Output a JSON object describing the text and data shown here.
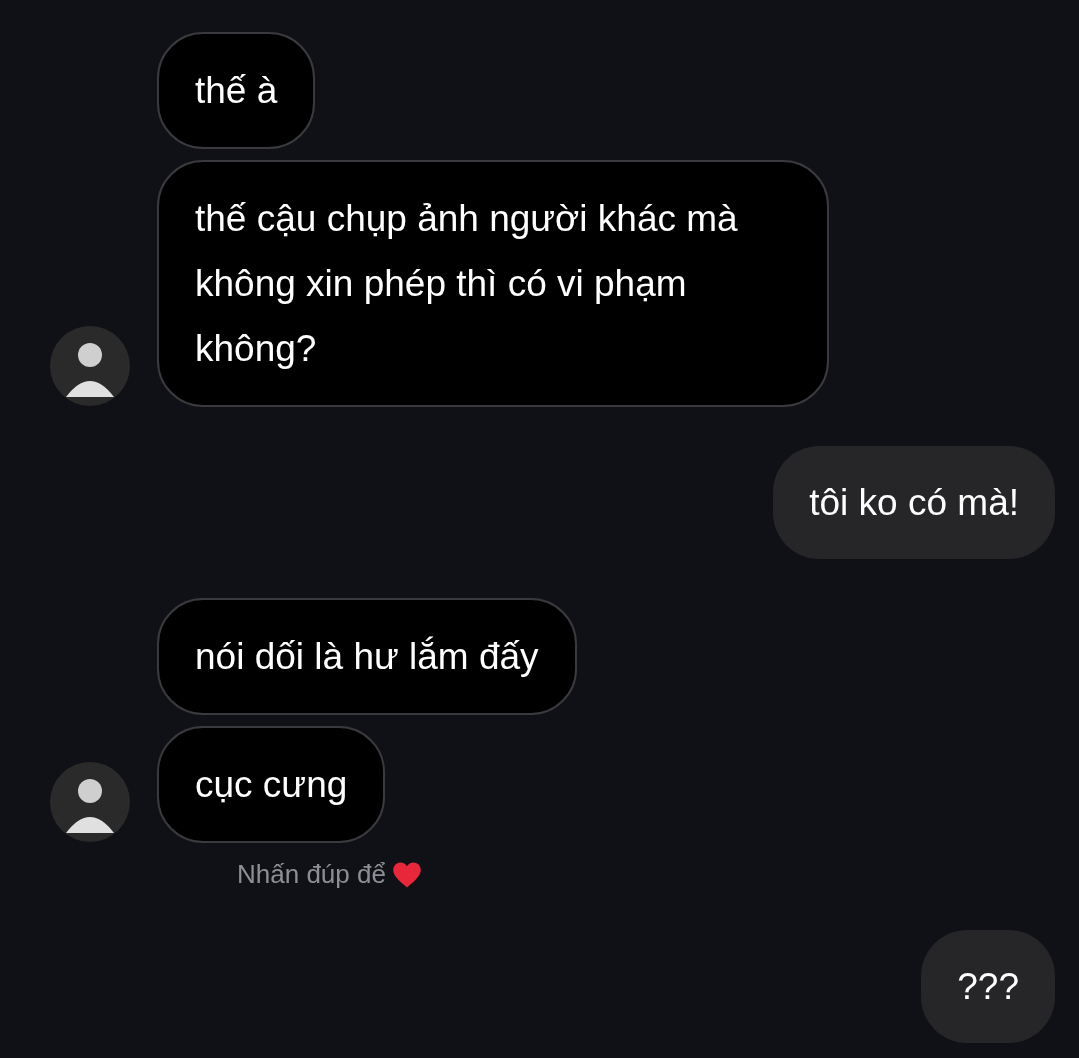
{
  "messages": [
    {
      "kind": "incoming",
      "text": "thế à",
      "show_avatar": false
    },
    {
      "kind": "incoming",
      "text": "thế cậu chụp ảnh người khác mà không xin phép thì có vi phạm không?",
      "show_avatar": true
    },
    {
      "kind": "outgoing",
      "text": "tôi ko có mà!"
    },
    {
      "kind": "incoming",
      "text": "nói dối là hư lắm đấy",
      "show_avatar": false
    },
    {
      "kind": "incoming",
      "text": "cục cưng",
      "show_avatar": true,
      "hint": "Nhấn đúp để"
    },
    {
      "kind": "outgoing",
      "text": "???"
    }
  ]
}
